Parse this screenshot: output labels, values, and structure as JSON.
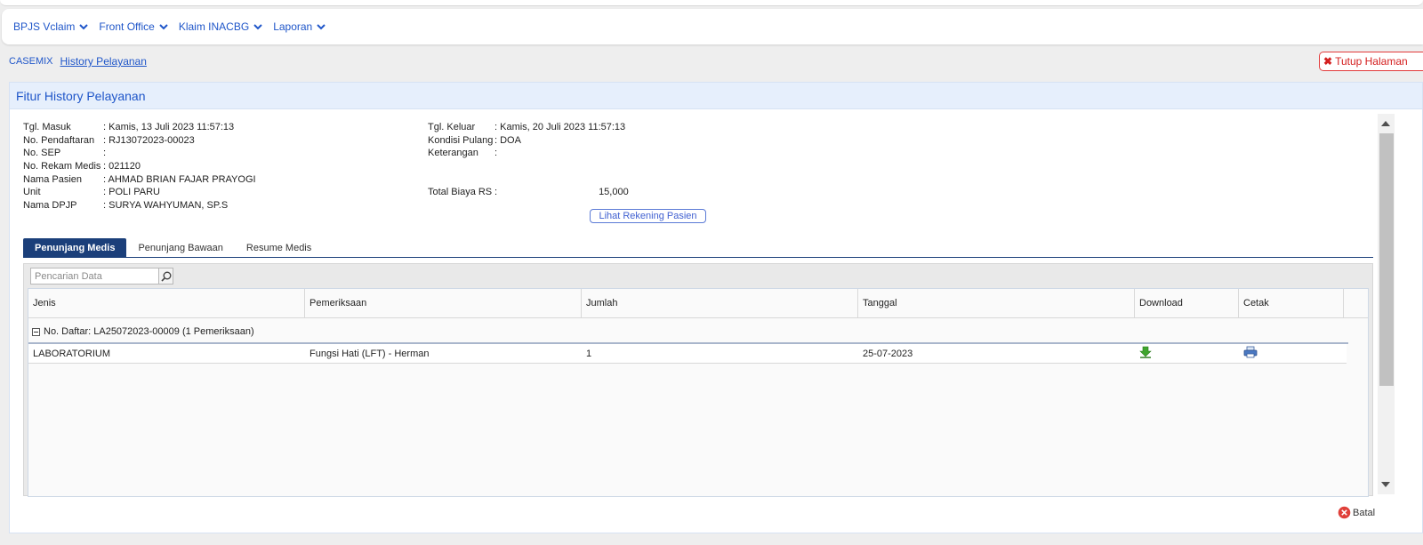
{
  "nav": {
    "items": [
      {
        "label": "BPJS Vclaim"
      },
      {
        "label": "Front Office"
      },
      {
        "label": "Klaim INACBG"
      },
      {
        "label": "Laporan"
      }
    ]
  },
  "breadcrumb": {
    "root": "CASEMIX",
    "current": "History Pelayanan"
  },
  "close_page": {
    "label": "Tutup Halaman"
  },
  "panel": {
    "title": "Fitur History Pelayanan"
  },
  "patient": {
    "left": [
      {
        "label": "Tgl. Masuk",
        "value": ": Kamis, 13 Juli 2023 11:57:13"
      },
      {
        "label": "No. Pendaftaran",
        "value": ": RJ13072023-00023"
      },
      {
        "label": "No. SEP",
        "value": ":"
      },
      {
        "label": "No. Rekam Medis",
        "value": ": 021120"
      },
      {
        "label": "Nama Pasien",
        "value": ": AHMAD BRIAN FAJAR PRAYOGI"
      },
      {
        "label": "Unit",
        "value": ": POLI PARU"
      },
      {
        "label": "Nama DPJP",
        "value": ": SURYA WAHYUMAN, SP.S"
      }
    ],
    "right": [
      {
        "label": "Tgl. Keluar",
        "value": ": Kamis, 20 Juli 2023 11:57:13"
      },
      {
        "label": "Kondisi Pulang",
        "value": ": DOA"
      },
      {
        "label": "Keterangan",
        "value": ":"
      }
    ],
    "total": {
      "label": "Total Biaya RS",
      "sep": ":",
      "value": "15,000"
    }
  },
  "rekening_button": "Lihat Rekening Pasien",
  "tabs": [
    {
      "label": "Penunjang Medis",
      "active": true
    },
    {
      "label": "Penunjang Bawaan",
      "active": false
    },
    {
      "label": "Resume Medis",
      "active": false
    }
  ],
  "search": {
    "placeholder": "Pencarian Data"
  },
  "table": {
    "columns": [
      "Jenis",
      "Pemeriksaan",
      "Jumlah",
      "Tanggal",
      "Download",
      "Cetak"
    ],
    "group": "No. Daftar: LA25072023-00009 (1 Pemeriksaan)",
    "rows": [
      {
        "jenis": "LABORATORIUM",
        "pemeriksaan": "Fungsi Hati (LFT) - Herman",
        "jumlah": "1",
        "tanggal": "25-07-2023"
      }
    ]
  },
  "footer": {
    "cancel": "Batal"
  },
  "colors": {
    "accent": "#1f56c9",
    "tab_active": "#1b3f7a",
    "danger": "#d42020",
    "header_bg": "#e6effc"
  },
  "icons": [
    "chevron-down-icon",
    "close-icon",
    "search-icon",
    "minus-square-icon",
    "download-icon",
    "printer-icon",
    "cancel-circle-icon"
  ]
}
